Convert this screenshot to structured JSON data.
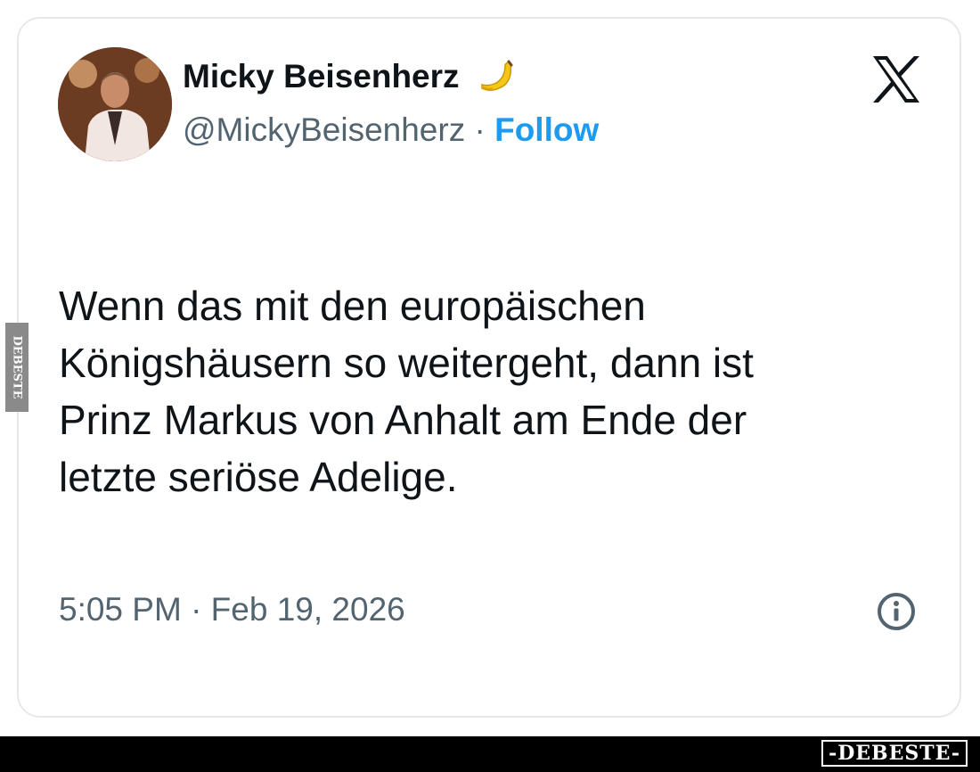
{
  "tweet": {
    "author": {
      "display_name": "Micky Beisenherz",
      "handle": "@MickyBeisenherz",
      "separator": "·",
      "follow_label": "Follow",
      "badge_icon": "banana-icon"
    },
    "platform_icon": "x-logo-icon",
    "text_lines": [
      "Wenn das mit den europäischen",
      "Königshäusern so weitergeht, dann ist",
      "Prinz Markus von Anhalt am Ende der",
      "letzte seriöse Adelige."
    ],
    "timestamp": "5:05 PM · Feb 19, 2026",
    "info_icon": "info-icon"
  },
  "watermark": {
    "side_text": "DEBESTE",
    "badge_text": "-DEBESTE-"
  },
  "colors": {
    "text_primary": "#0f1419",
    "text_secondary": "#536471",
    "link": "#1d9bf0",
    "card_border": "#e6e8ea"
  }
}
